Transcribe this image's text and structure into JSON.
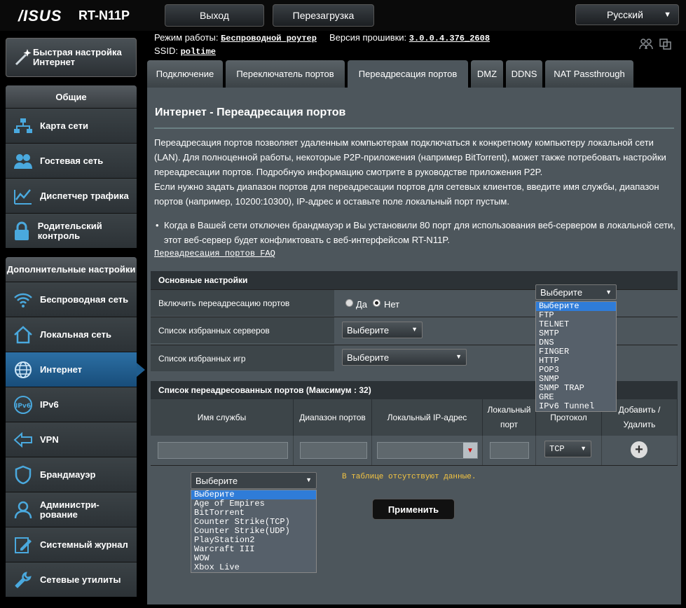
{
  "header": {
    "brand": "/ISUS",
    "model": "RT-N11P",
    "logout_label": "Выход",
    "reboot_label": "Перезагрузка",
    "language": "Русский"
  },
  "info": {
    "mode_label": "Режим работы:",
    "mode_value": "Беспроводной роутер",
    "fw_label": "Версия прошивки:",
    "fw_value": "3.0.0.4.376_2608",
    "ssid_label": "SSID:",
    "ssid_value": "poltime"
  },
  "sidebar": {
    "quick": "Быстрая настройка Интернет",
    "general_header": "Общие",
    "general": [
      {
        "label": "Карта сети",
        "icon": "network-map-icon"
      },
      {
        "label": "Гостевая сеть",
        "icon": "guest-network-icon"
      },
      {
        "label": "Диспетчер трафика",
        "icon": "traffic-manager-icon"
      },
      {
        "label": "Родительский контроль",
        "icon": "parental-control-icon"
      }
    ],
    "advanced_header": "Дополнительные настройки",
    "advanced": [
      {
        "label": "Беспроводная сеть",
        "icon": "wireless-icon"
      },
      {
        "label": "Локальная сеть",
        "icon": "lan-icon"
      },
      {
        "label": "Интернет",
        "icon": "internet-icon"
      },
      {
        "label": "IPv6",
        "icon": "ipv6-icon"
      },
      {
        "label": "VPN",
        "icon": "vpn-icon"
      },
      {
        "label": "Брандмауэр",
        "icon": "firewall-icon"
      },
      {
        "label": "Администри-рование",
        "icon": "administration-icon"
      },
      {
        "label": "Системный журнал",
        "icon": "system-log-icon"
      },
      {
        "label": "Сетевые утилиты",
        "icon": "network-tools-icon"
      }
    ]
  },
  "tabs": [
    {
      "label": "Подключение"
    },
    {
      "label": "Переключатель портов"
    },
    {
      "label": "Переадресация портов"
    },
    {
      "label": "DMZ"
    },
    {
      "label": "DDNS"
    },
    {
      "label": "NAT Passthrough"
    }
  ],
  "main": {
    "title": "Интернет - Переадресация портов",
    "desc1": "Переадресация портов позволяет удаленным компьютерам подключаться к конкретному компьютеру локальной сети (LAN). Для полноценной работы, некоторые P2P-приложения (например BitTorrent), может также потребовать настройки переадресации портов. Подробную информацию смотрите в руководстве приложения P2P.",
    "desc2": "Если нужно задать диапазон портов для переадресации портов для сетевых клиентов, введите имя службы, диапазон портов (например, 10200:10300), IP-адрес и оставьте поле локальный порт пустым.",
    "bullet": "Когда в Вашей сети отключен брандмауэр и Вы установили 80 порт для использования веб-сервером в локальной сети, этот веб-сервер будет конфликтовать с веб-интерфейсом RT-N11P.",
    "faq": "Переадресация портов FAQ"
  },
  "basic": {
    "header": "Основные настройки",
    "enable_label": "Включить переадресацию портов",
    "yes": "Да",
    "no": "Нет",
    "servers_label": "Список избранных серверов",
    "games_label": "Список избранных игр",
    "select_placeholder": "Выберите"
  },
  "list": {
    "header": "Список переадресованных портов (Максимум : 32)",
    "columns": [
      "Имя службы",
      "Диапазон портов",
      "Локальный IP-адрес",
      "Локальный порт",
      "Протокол",
      "Добавить / Удалить"
    ],
    "protocol": "TCP",
    "empty": "В таблице отсутствуют данные."
  },
  "server_options": [
    "Выберите",
    "FTP",
    "TELNET",
    "SMTP",
    "DNS",
    "FINGER",
    "HTTP",
    "POP3",
    "SNMP",
    "SNMP TRAP",
    "GRE",
    "IPv6 Tunnel"
  ],
  "game_options": [
    "Выберите",
    "Age of Empires",
    "BitTorrent",
    "Counter Strike(TCP)",
    "Counter Strike(UDP)",
    "PlayStation2",
    "Warcraft III",
    "WOW",
    "Xbox Live"
  ],
  "apply_label": "Применить",
  "colors": {
    "accent": "#2f7cd8",
    "active_nav": "#1f5d8f",
    "warning": "#f5c542"
  }
}
